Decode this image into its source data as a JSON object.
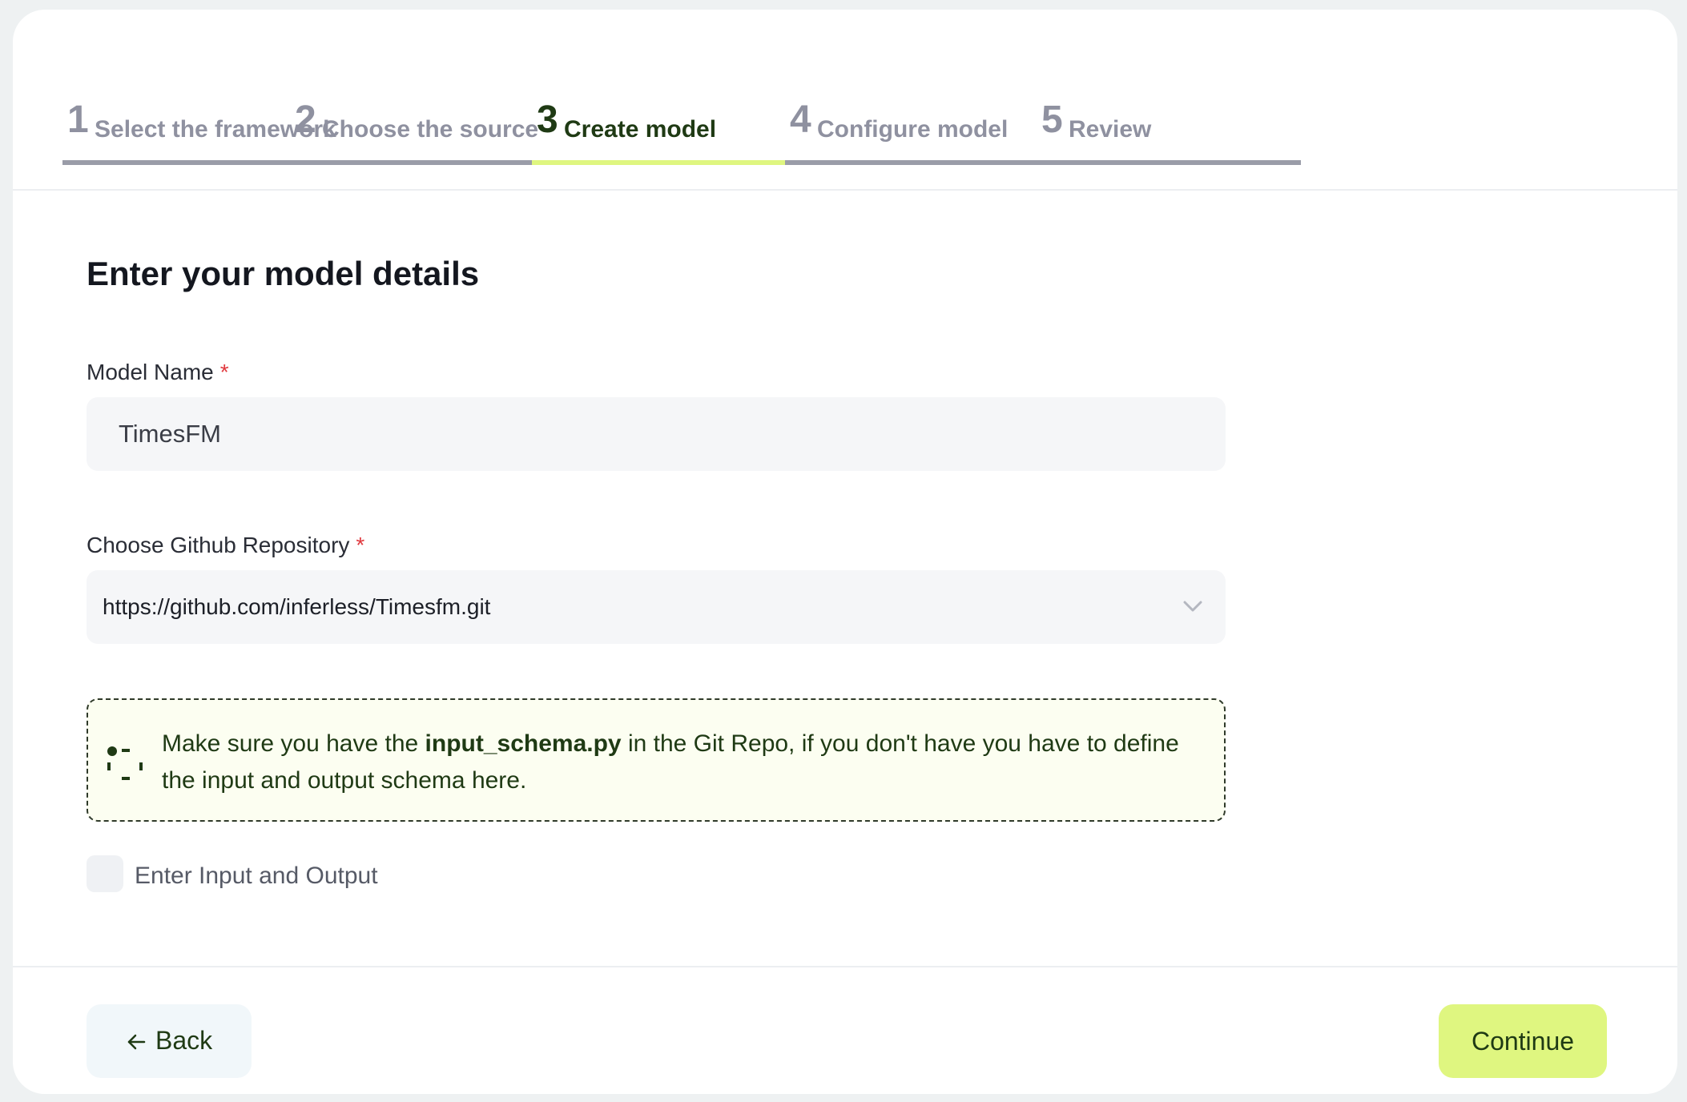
{
  "stepper": {
    "steps": [
      {
        "number": "1",
        "label": "Select the framework",
        "state": "inactive"
      },
      {
        "number": "2",
        "label": "Choose the source",
        "state": "inactive"
      },
      {
        "number": "3",
        "label": "Create model",
        "state": "active"
      },
      {
        "number": "4",
        "label": "Configure model",
        "state": "inactive"
      },
      {
        "number": "5",
        "label": "Review",
        "state": "inactive"
      }
    ]
  },
  "form": {
    "title": "Enter your model details",
    "model_name": {
      "label": "Model Name",
      "required_mark": "*",
      "value": "TimesFM"
    },
    "repository": {
      "label": "Choose Github Repository",
      "required_mark": "*",
      "selected": "https://github.com/inferless/Timesfm.git"
    },
    "notice": {
      "text_before": "Make sure you have the ",
      "highlight": "input_schema.py",
      "text_after": " in the Git Repo, if you don't have you have to define the input and output schema here."
    },
    "checkbox": {
      "label": "Enter Input and Output",
      "checked": false
    }
  },
  "footer": {
    "back_label": "Back",
    "continue_label": "Continue"
  },
  "colors": {
    "accent": "#dff680",
    "accent_text": "#1f3a14",
    "required": "#e0393e",
    "inactive_step": "#9a9ca8",
    "notice_bg": "#fcfef1"
  }
}
